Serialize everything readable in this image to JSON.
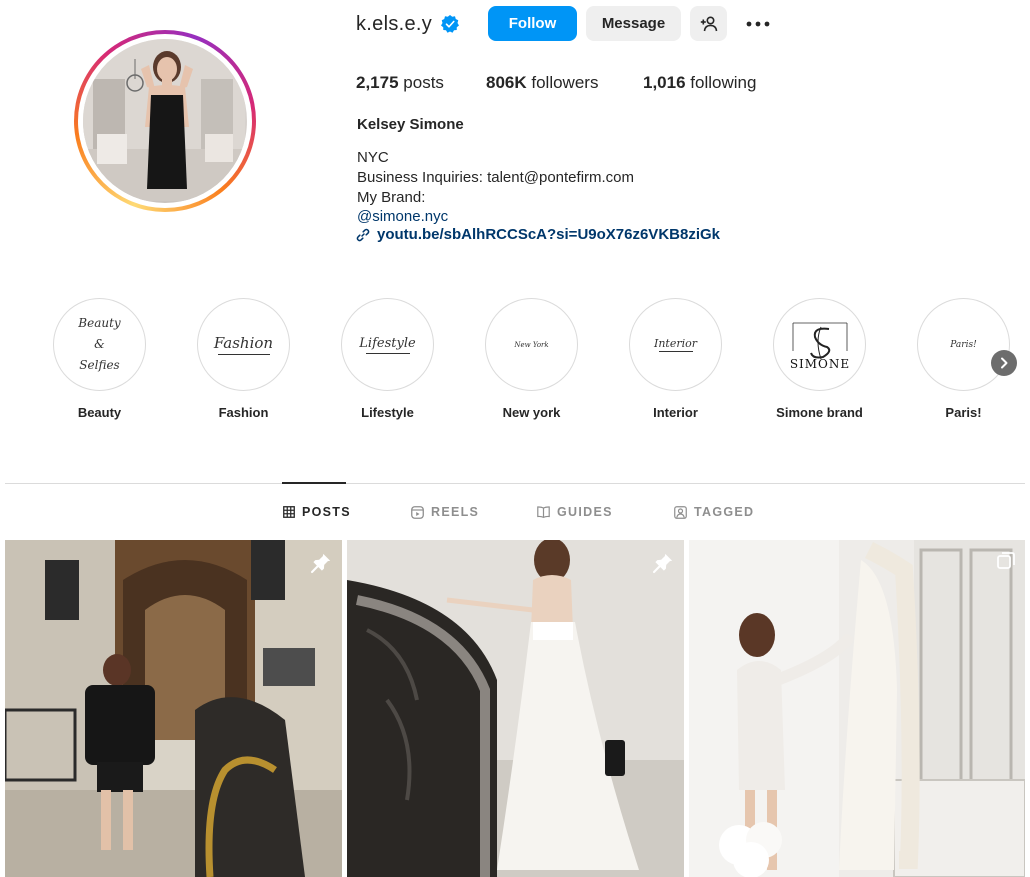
{
  "profile": {
    "username": "k.els.e.y",
    "full_name": "Kelsey Simone",
    "buttons": {
      "follow": "Follow",
      "message": "Message",
      "more": "•••"
    },
    "stats": {
      "posts_value": "2,175",
      "posts_label": "posts",
      "followers_value": "806K",
      "followers_label": "followers",
      "following_value": "1,016",
      "following_label": "following"
    },
    "bio": {
      "line1": "NYC",
      "line2": "Business Inquiries: talent@pontefirm.com",
      "line3": "My Brand:",
      "mention": "@simone.nyc",
      "link": "youtu.be/sbAlhRCCScA?si=U9oX76z6VKB8ziGk"
    }
  },
  "highlights": [
    {
      "cover_lines": [
        "Beauty",
        "&",
        "Selfies"
      ],
      "label": "Beauty"
    },
    {
      "cover_lines": [
        "Fashion"
      ],
      "label": "Fashion"
    },
    {
      "cover_lines": [
        "Lifestyle"
      ],
      "label": "Lifestyle"
    },
    {
      "cover_lines": [
        "New York"
      ],
      "label": "New york"
    },
    {
      "cover_lines": [
        "Interior"
      ],
      "label": "Interior"
    },
    {
      "cover_lines": [
        "SIMONE"
      ],
      "label": "Simone brand"
    },
    {
      "cover_lines": [
        "Paris!"
      ],
      "label": "Paris!"
    }
  ],
  "tabs": [
    {
      "label": "POSTS",
      "icon": "grid-icon",
      "active": true
    },
    {
      "label": "REELS",
      "icon": "reels-icon",
      "active": false
    },
    {
      "label": "GUIDES",
      "icon": "guides-icon",
      "active": false
    },
    {
      "label": "TAGGED",
      "icon": "tagged-icon",
      "active": false
    }
  ],
  "colors": {
    "follow_button": "#0095f6",
    "link": "#00376b",
    "verified_badge": "#0095f6"
  },
  "posts": [
    {
      "pinned": true,
      "icon": "pin-icon"
    },
    {
      "pinned": true,
      "icon": "pin-icon"
    },
    {
      "pinned": false,
      "icon": "carousel-icon"
    }
  ]
}
